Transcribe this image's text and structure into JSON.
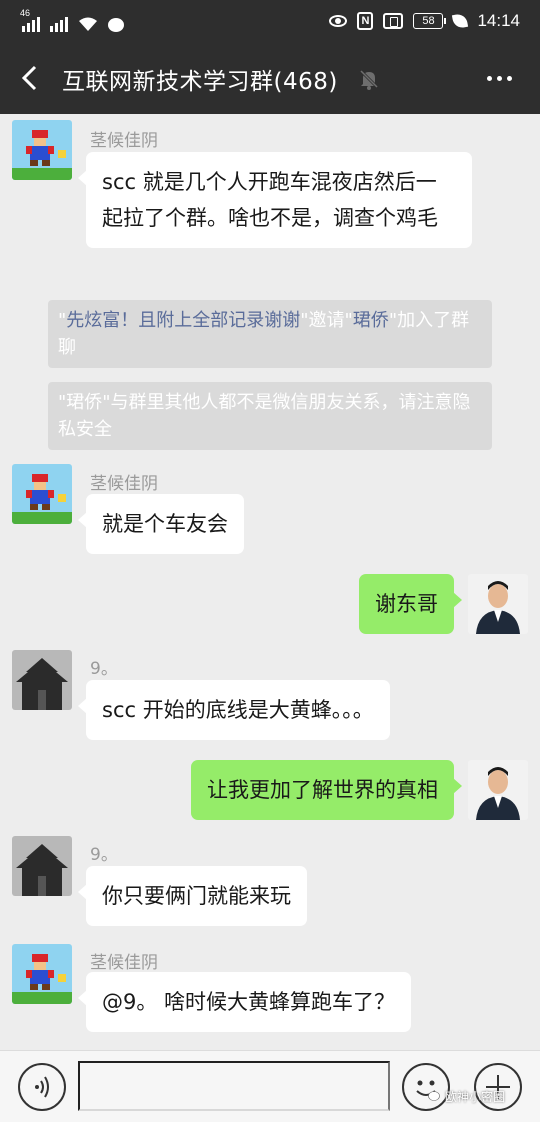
{
  "status_bar": {
    "network_tag": "46",
    "battery": "58",
    "time": "14:14"
  },
  "header": {
    "title": "互联网新技术学习群(468)"
  },
  "messages": [
    {
      "sender": "茎候佳阴",
      "text": "scc 就是几个人开跑车混夜店然后一起拉了个群。啥也不是，调查个鸡毛"
    },
    {
      "system_parts": [
        "\"",
        "先炫富！且附上全部记录谢谢",
        "\"邀请\"",
        "珺侨",
        "\"加入了群聊"
      ]
    },
    {
      "system": "\"珺侨\"与群里其他人都不是微信朋友关系，请注意隐私安全"
    },
    {
      "sender": "茎候佳阴",
      "text": "就是个车友会"
    },
    {
      "text": "谢东哥"
    },
    {
      "sender": "9。",
      "text": "scc 开始的底线是大黄蜂。。。"
    },
    {
      "text": "让我更加了解世界的真相"
    },
    {
      "sender": "9。",
      "text": "你只要俩门就能来玩"
    },
    {
      "sender": "茎候佳阴",
      "text": "@9。 啥时候大黄蜂算跑车了？"
    }
  ],
  "input_bar": {
    "value": ""
  },
  "watermark": "欧神小密圈",
  "colors": {
    "header_bg": "#2e2e2e",
    "chat_bg": "#ededed",
    "outgoing_bubble": "#95ec69",
    "system_bg": "#dadada",
    "system_highlight": "#5a6c9a"
  }
}
